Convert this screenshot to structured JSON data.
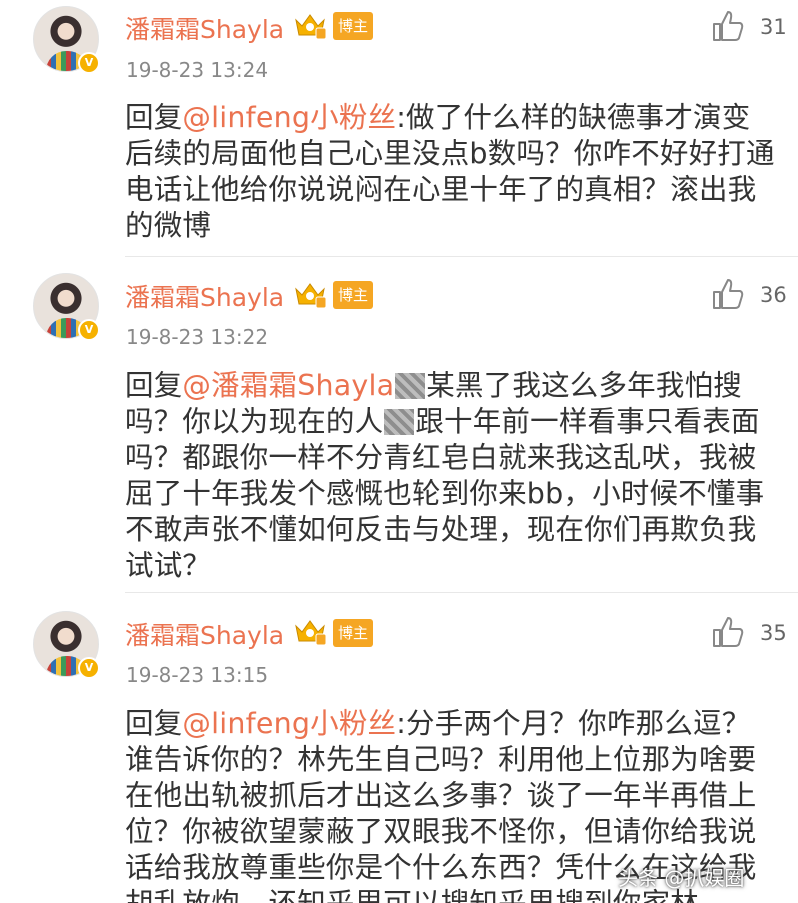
{
  "comments": [
    {
      "username": "潘霜霜Shayla",
      "role_badge": "博主",
      "verified_mark": "V",
      "likes": "31",
      "timestamp": "19-8-23 13:24",
      "reply_prefix": "回复",
      "mention": "@linfeng小粉丝",
      "text": ":做了什么样的缺德事才演变后续的局面他自己心里没点b数吗？你咋不好好打通电话让他给你说说闷在心里十年了的真相？滚出我的微博"
    },
    {
      "username": "潘霜霜Shayla",
      "role_badge": "博主",
      "verified_mark": "V",
      "likes": "36",
      "timestamp": "19-8-23 13:22",
      "reply_prefix": "回复",
      "mention": "@潘霜霜Shayla",
      "text_part1": "某黑了我这么多年我怕搜吗？你以为现在的人",
      "text_part2": "跟十年前一样看事只看表面吗？都跟你一样不分青红皂白就来我这乱吠，我被屈了十年我发个感慨也轮到你来bb，小时候不懂事不敢声张不懂如何反击与处理，现在你们再欺负我试试？"
    },
    {
      "username": "潘霜霜Shayla",
      "role_badge": "博主",
      "verified_mark": "V",
      "likes": "35",
      "timestamp": "19-8-23 13:15",
      "reply_prefix": "回复",
      "mention": "@linfeng小粉丝",
      "text": ":分手两个月？你咋那么逗？谁告诉你的？林先生自己吗？利用他上位那为啥要在他出轨被抓后才出这么多事？谈了一年半再借上位？你被欲望蒙蔽了双眼我不怪你，但请你给我说话给我放尊重些你是个什么东西？凭什么在这给我胡乱放炮，还知乎里可以搜知乎里搜到你家林"
    }
  ],
  "watermark": "头条 @扒娱圈",
  "icons": {
    "like": "thumbs-up-icon",
    "crown": "crown-level-icon",
    "verified": "verified-v-icon"
  },
  "colors": {
    "username": "#eb7350",
    "role_badge": "#f5a623",
    "verified": "#f6b100",
    "text": "#333333",
    "meta": "#888888"
  }
}
